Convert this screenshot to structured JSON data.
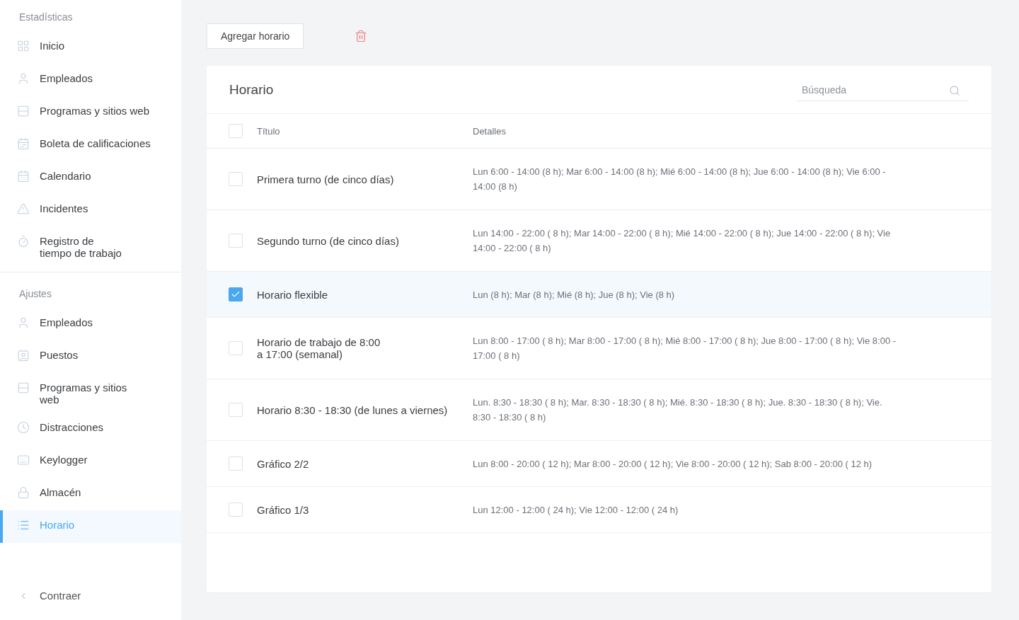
{
  "sidebar": {
    "sections": [
      {
        "title": "Estadísticas",
        "items": [
          {
            "label": "Inicio",
            "selected": false
          },
          {
            "label": "Empleados",
            "selected": false
          },
          {
            "label": "Programas y sitios web",
            "selected": false
          },
          {
            "label": "Boleta de calificaciones",
            "selected": false
          },
          {
            "label": "Calendario",
            "selected": false
          },
          {
            "label": "Incidentes",
            "selected": false
          },
          {
            "label": "Registro de\ntiempo de trabajo",
            "selected": false
          }
        ]
      },
      {
        "title": "Ajustes",
        "items": [
          {
            "label": "Empleados",
            "selected": false
          },
          {
            "label": "Puestos",
            "selected": false
          },
          {
            "label": "Programas y sitios\nweb",
            "selected": false
          },
          {
            "label": "Distracciones",
            "selected": false
          },
          {
            "label": "Keylogger",
            "selected": false
          },
          {
            "label": "Almacén",
            "selected": false
          },
          {
            "label": "Horario",
            "selected": true
          }
        ]
      }
    ],
    "collapse": "Contraer"
  },
  "toolbar": {
    "add_button": "Agregar horario"
  },
  "card": {
    "title": "Horario",
    "search": {
      "placeholder": "Búsqueda"
    },
    "columns": [
      "Título",
      "Detalles"
    ],
    "header_checked": false,
    "rows": [
      {
        "title": "Primera turno (de cinco días)",
        "details": "Lun 6:00 - 14:00 (8 h); Mar 6:00 - 14:00 (8 h); Mié 6:00 - 14:00 (8 h); Jue 6:00 - 14:00 (8 h); Vie 6:00 - 14:00 (8 h)",
        "checked": false
      },
      {
        "title": "Segundo turno (de cinco días)",
        "details": "Lun 14:00 - 22:00 ( 8 h);  Mar 14:00 - 22:00 ( 8 h);  Mié 14:00 - 22:00 ( 8 h);  Jue 14:00 - 22:00 ( 8 h);  Vie 14:00 - 22:00 ( 8 h)",
        "checked": false
      },
      {
        "title": "Horario flexible",
        "details": "Lun (8 h); Mar (8 h); Mié (8 h); Jue (8 h); Vie (8 h)",
        "checked": true
      },
      {
        "title": "Horario de trabajo de 8:00\na 17:00 (semanal)",
        "details": "Lun 8:00 - 17:00 ( 8 h); Mar 8:00 - 17:00 ( 8 h); Mié 8:00 - 17:00 ( 8 h); Jue 8:00 - 17:00 ( 8 h); Vie 8:00 - 17:00 ( 8 h)",
        "checked": false
      },
      {
        "title": "Horario 8:30 - 18:30 (de lunes a viernes)",
        "details": "Lun. 8:30 - 18:30 ( 8 h); Mar. 8:30 - 18:30 ( 8 h); Mié. 8:30 - 18:30 ( 8 h); Jue. 8:30 - 18:30 ( 8 h); Vie. 8:30 - 18:30 ( 8 h)",
        "checked": false
      },
      {
        "title": "Gráfico 2/2",
        "details": "Lun 8:00 - 20:00  ( 12 h); Mar 8:00 - 20:00  ( 12 h); Vie 8:00 - 20:00  ( 12 h); Sab 8:00 - 20:00  ( 12 h)",
        "checked": false
      },
      {
        "title": "Gráfico 1/3",
        "details": "Lun 12:00 - 12:00 ( 24 h); Vie 12:00 - 12:00 ( 24 h)",
        "checked": false
      }
    ]
  }
}
